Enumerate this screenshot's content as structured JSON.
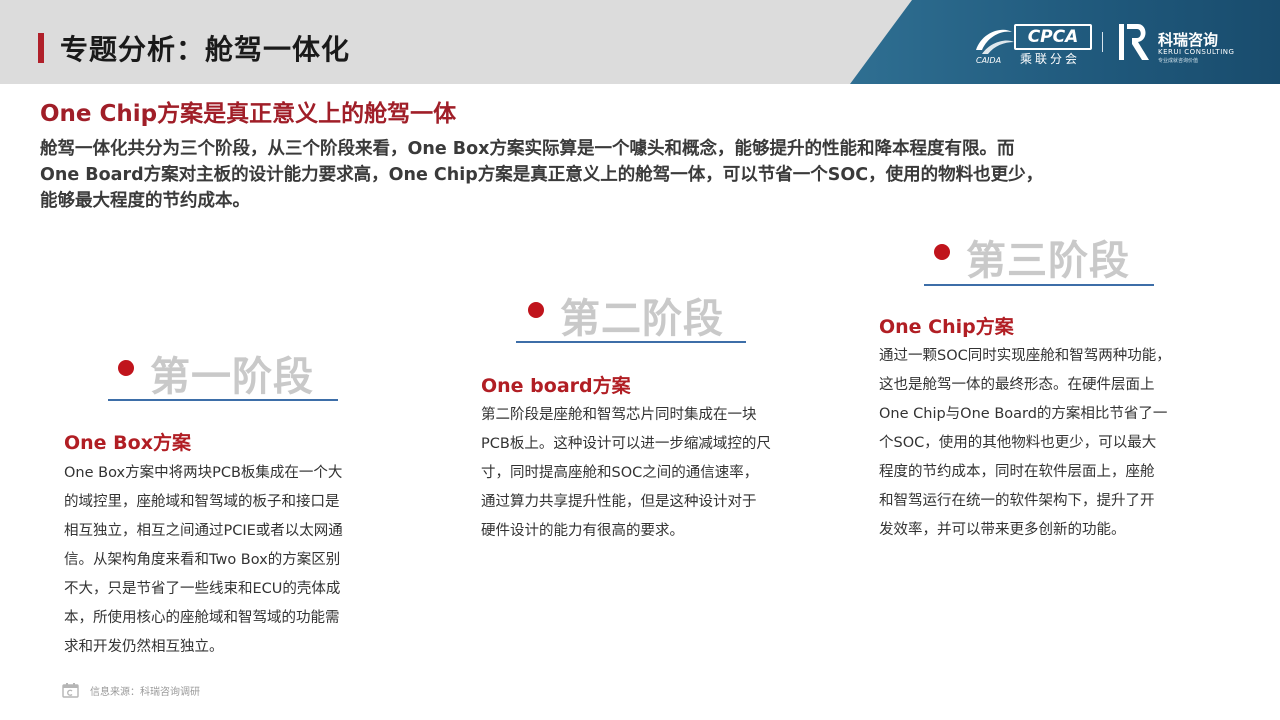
{
  "header": {
    "title": "专题分析：舱驾一体化",
    "logo_cpca": {
      "box_text": "CPCA",
      "sub_text": "乘联分会",
      "mark_text": "CAIDA"
    },
    "logo_kerui": {
      "cn_text": "科瑞咨询",
      "en_text": "KERUI CONSULTING",
      "tag_text": "专业成就咨询价值"
    }
  },
  "section": {
    "title": "One Chip方案是真正意义上的舱驾一体",
    "intro_lines": [
      "舱驾一体化共分为三个阶段，从三个阶段来看，One Box方案实际算是一个噱头和概念，能够提升的性能和降本程度有限。而",
      "One Board方案对主板的设计能力要求高，One Chip方案是真正意义上的舱驾一体，可以节省一个SOC，使用的物料也更少，",
      "能够最大程度的节约成本。"
    ]
  },
  "stages": [
    {
      "label": "第一阶段",
      "plan_title": "One Box方案",
      "body_lines": [
        "One Box方案中将两块PCB板集成在一个大",
        "的域控里，座舱域和智驾域的板子和接口是",
        "相互独立，相互之间通过PCIE或者以太网通",
        "信。从架构角度来看和Two Box的方案区别",
        "不大，只是节省了一些线束和ECU的壳体成",
        "本，所使用核心的座舱域和智驾域的功能需",
        "求和开发仍然相互独立。"
      ]
    },
    {
      "label": "第二阶段",
      "plan_title": "One board方案",
      "body_lines": [
        "第二阶段是座舱和智驾芯片同时集成在一块",
        "PCB板上。这种设计可以进一步缩减域控的尺",
        "寸，同时提高座舱和SOC之间的通信速率，",
        "通过算力共享提升性能，但是这种设计对于",
        "硬件设计的能力有很高的要求。"
      ]
    },
    {
      "label": "第三阶段",
      "plan_title": "One Chip方案",
      "body_lines": [
        "通过一颗SOC同时实现座舱和智驾两种功能，",
        "这也是舱驾一体的最终形态。在硬件层面上",
        "One Chip与One Board的方案相比节省了一",
        "个SOC，使用的其他物料也更少，可以最大",
        "程度的节约成本，同时在软件层面上，座舱",
        "和智驾运行在统一的软件架构下，提升了开",
        "发效率，并可以带来更多创新的功能。"
      ]
    }
  ],
  "footer": {
    "source": "信息来源：科瑞咨询调研"
  },
  "colors": {
    "accent_red": "#a01e28",
    "stage_gray": "#c9c9c9",
    "underline_blue": "#3d6ea8",
    "header_gray": "#dcdcdc",
    "logo_panel_blue": "#1f587b"
  },
  "icons": [
    "cpca-logo-icon",
    "kerui-logo-icon",
    "calendar-icon"
  ]
}
